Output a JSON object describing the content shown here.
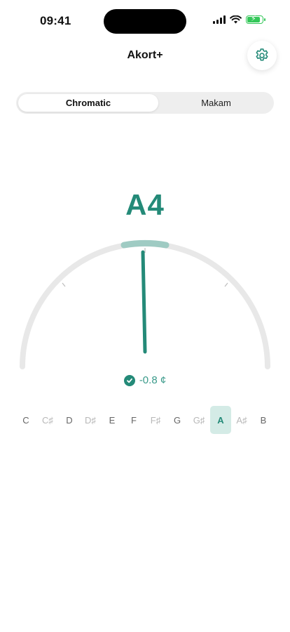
{
  "status_bar": {
    "time": "09:41"
  },
  "header": {
    "title": "Akort+",
    "settings_icon": "gear-icon"
  },
  "mode_toggle": {
    "options": [
      "Chromatic",
      "Makam"
    ],
    "selected": "Chromatic"
  },
  "tuner": {
    "note": "A4",
    "cents_text": "-0.8 ¢",
    "cents_value": -0.8,
    "in_tune": true,
    "accent_color": "#248a78"
  },
  "note_strip": {
    "notes": [
      "C",
      "C♯",
      "D",
      "D♯",
      "E",
      "F",
      "F♯",
      "G",
      "G♯",
      "A",
      "A♯",
      "B"
    ],
    "active": "A"
  }
}
